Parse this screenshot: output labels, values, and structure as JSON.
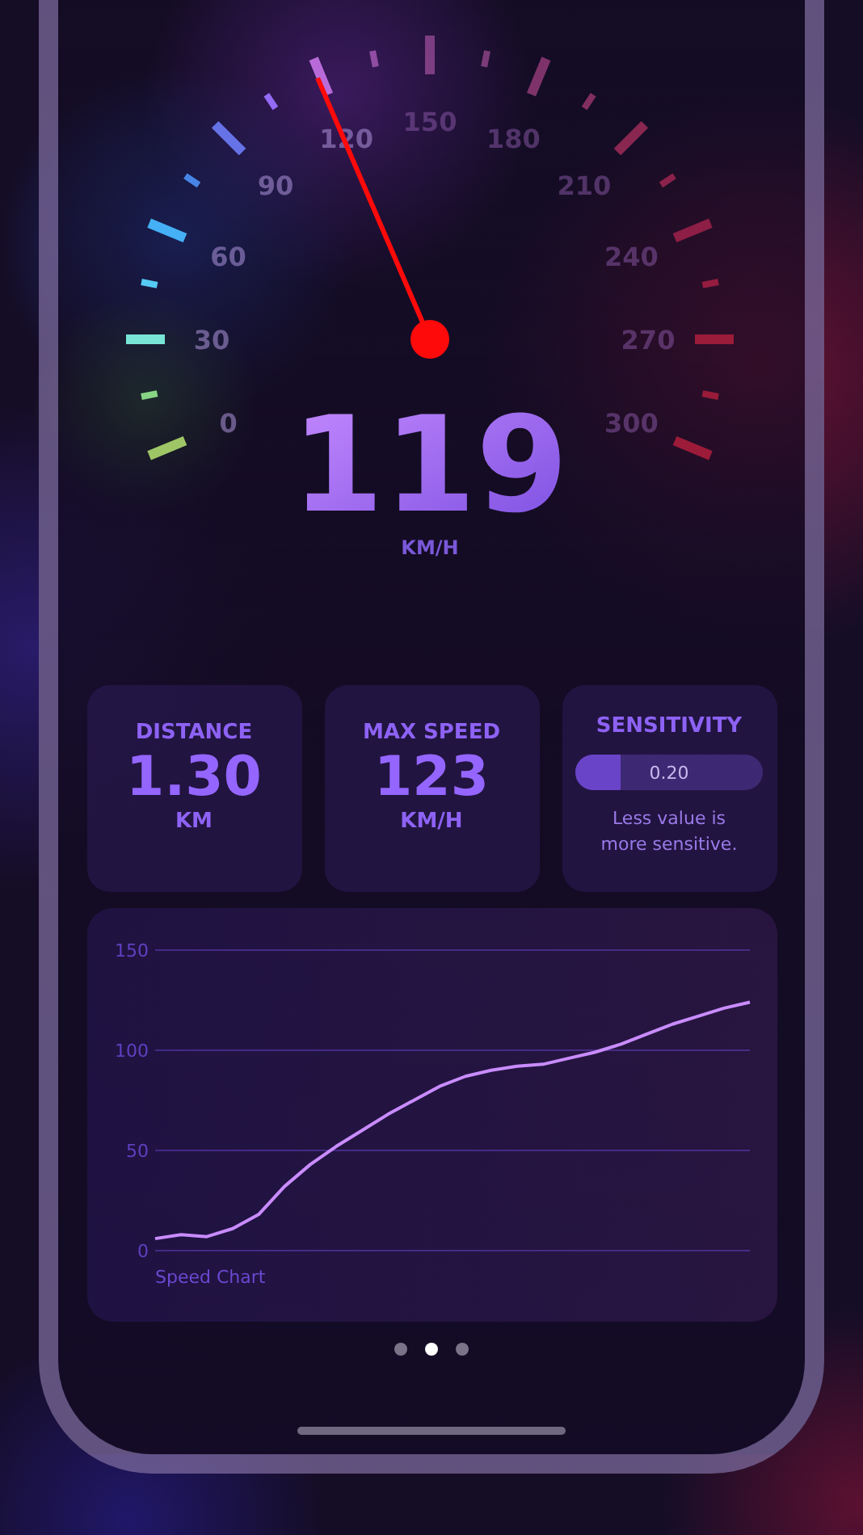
{
  "gauge": {
    "scale_labels": [
      "0",
      "30",
      "60",
      "90",
      "120",
      "150",
      "180",
      "210",
      "240",
      "270",
      "300"
    ],
    "speed": "119",
    "unit": "KM/H"
  },
  "stats": [
    {
      "kind": "stat",
      "title": "DISTANCE",
      "value": "1.30",
      "unit": "KM"
    },
    {
      "kind": "stat",
      "title": "MAX SPEED",
      "value": "123",
      "unit": "KM/H"
    },
    {
      "kind": "slider",
      "title": "SENSITIVITY",
      "reading": "0.20",
      "level": 0.24,
      "note": "Less value is more sensitive."
    }
  ],
  "chart": {
    "chart_data": {
      "type": "line",
      "title": "Speed Chart",
      "ylim": [
        0,
        150
      ],
      "yticks": [
        0,
        50,
        100,
        150
      ],
      "series": [
        {
          "color": "#c98cff",
          "values": [
            6,
            8,
            7,
            11,
            18,
            32,
            43,
            52,
            60,
            68,
            75,
            82,
            87,
            90,
            92,
            93,
            96,
            99,
            103,
            108,
            113,
            117,
            121,
            124
          ]
        }
      ]
    }
  },
  "page_dots": [
    {
      "selected": false
    },
    {
      "selected": true
    },
    {
      "selected": false
    }
  ]
}
